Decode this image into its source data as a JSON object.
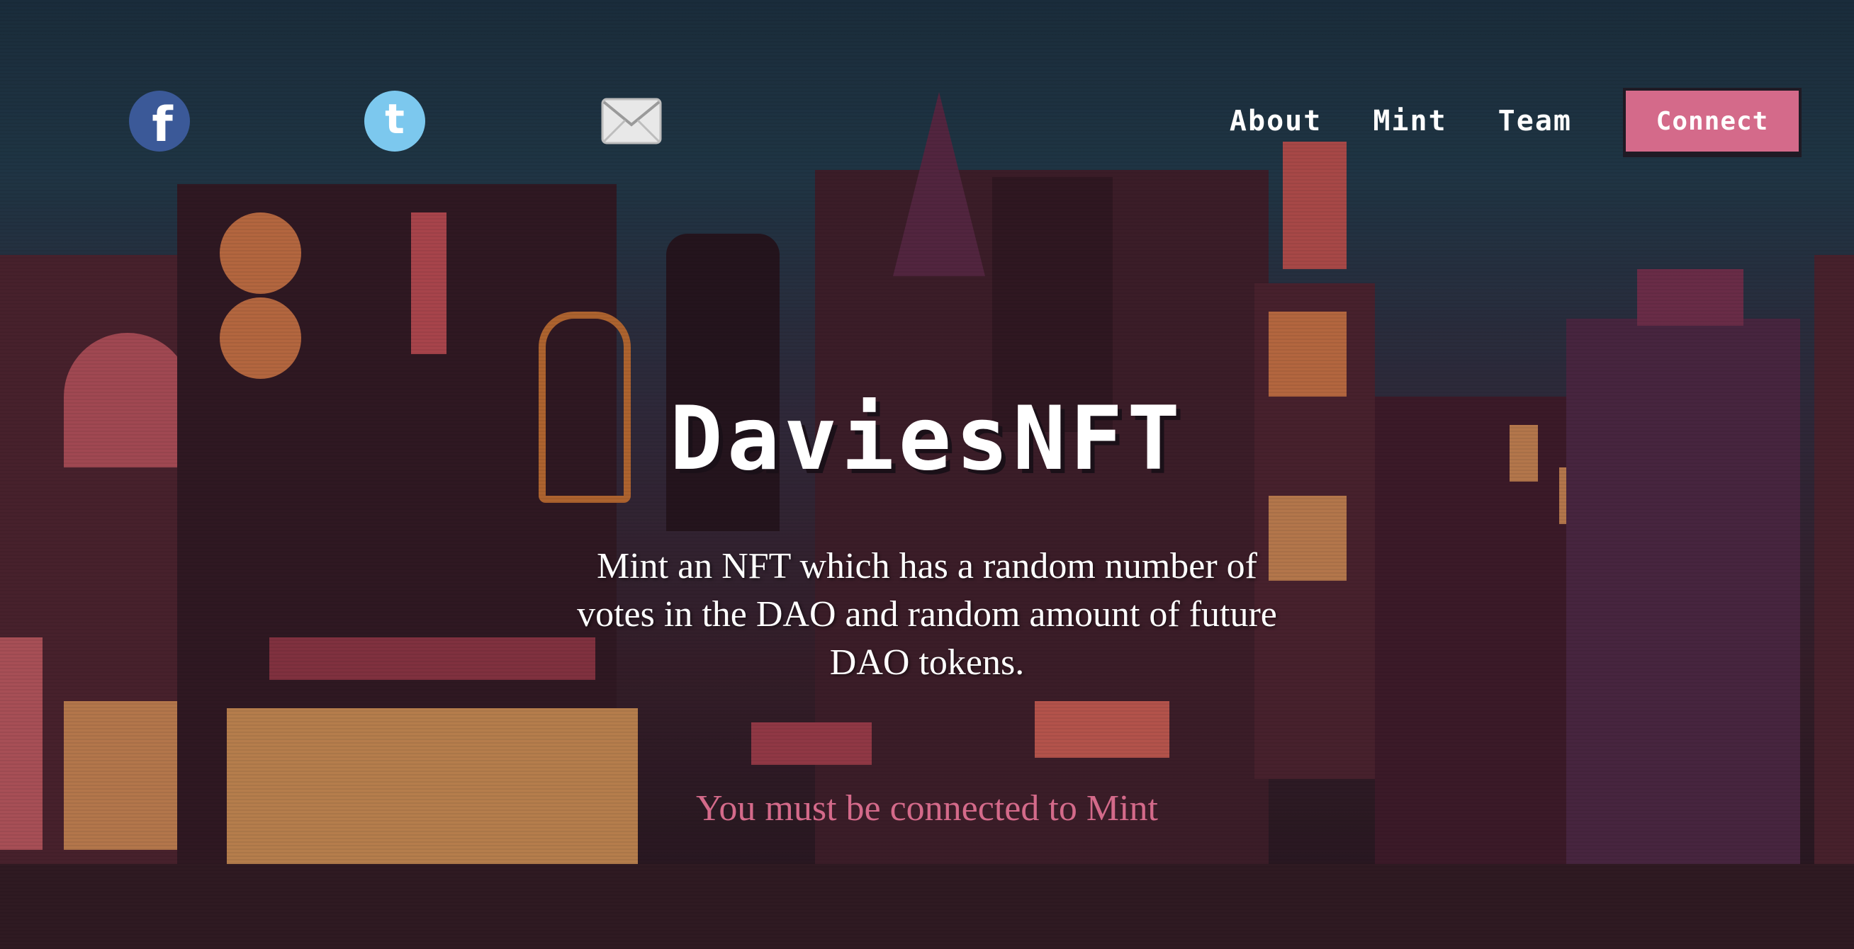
{
  "social": {
    "facebook_icon": "facebook-icon",
    "twitter_icon": "twitter-icon",
    "mail_icon": "envelope-icon"
  },
  "nav": {
    "about": "About",
    "mint": "Mint",
    "team": "Team",
    "connect": "Connect"
  },
  "hero": {
    "title": "DaviesNFT",
    "description": "Mint an NFT which has a random number of votes in the DAO and random amount of future DAO tokens.",
    "notice": "You must be connected to Mint"
  },
  "colors": {
    "accent": "#d46a8a",
    "text": "#ffffff",
    "facebook": "#3b5998",
    "twitter": "#7cc8ee"
  }
}
